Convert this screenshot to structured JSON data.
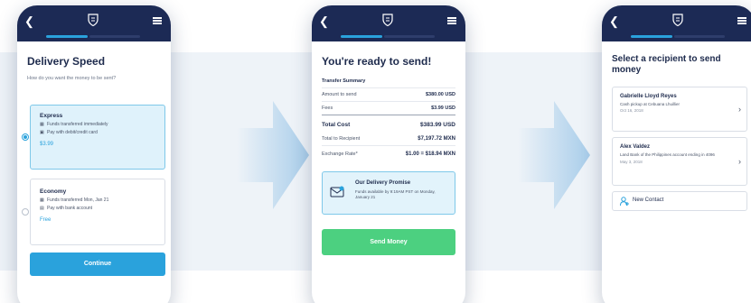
{
  "screen1": {
    "title": "Delivery Speed",
    "subtitle": "How do you want the money to be sent?",
    "options": [
      {
        "title": "Express",
        "features": [
          "Funds transferred immediately",
          "Pay with debit/credit card"
        ],
        "price": "$3.99",
        "selected": true
      },
      {
        "title": "Economy",
        "features": [
          "Funds transferred Mon, Jan 21",
          "Pay with bank account"
        ],
        "price": "Free",
        "selected": false
      }
    ],
    "continue_label": "Continue"
  },
  "screen2": {
    "title": "You're ready to send!",
    "summary_heading": "Transfer Summary",
    "amount_label": "Amount to send",
    "amount_value": "$380.00 USD",
    "fees_label": "Fees",
    "fees_value": "$3.99 USD",
    "total_cost_label": "Total Cost",
    "total_cost_value": "$383.99 USD",
    "total_recipient_label": "Total to Recipient",
    "total_recipient_value": "$7,197.72 MXN",
    "exchange_label": "Exchange Rate*",
    "exchange_value": "$1.00 = $18.94 MXN",
    "promise_title": "Our Delivery Promise",
    "promise_text": "Funds available by 9:19AM PST on Monday, January 21",
    "send_label": "Send Money"
  },
  "screen3": {
    "title": "Select a recipient to send money",
    "recipients": [
      {
        "name": "Gabrielle Lloyd Reyes",
        "detail": "Cash pickup at Cebuana Lhuillier",
        "date": "Oct 16, 2018"
      },
      {
        "name": "Alex Valdez",
        "detail": "Land Bank of the Philippines account ending in 4096",
        "date": "May 3, 2018"
      }
    ],
    "new_contact_label": "New Contact"
  },
  "colors": {
    "header_navy": "#1c2a55",
    "accent_blue": "#2aa2dc",
    "send_green": "#4cd080",
    "selected_bg": "#dff2fb",
    "backdrop": "#eef3f8"
  },
  "icons": [
    "back-arrow-icon",
    "shield-logo-icon",
    "hamburger-menu-icon",
    "bank-icon",
    "card-icon",
    "envelope-check-icon",
    "chevron-right-icon",
    "person-add-icon",
    "flow-arrow-icon"
  ]
}
